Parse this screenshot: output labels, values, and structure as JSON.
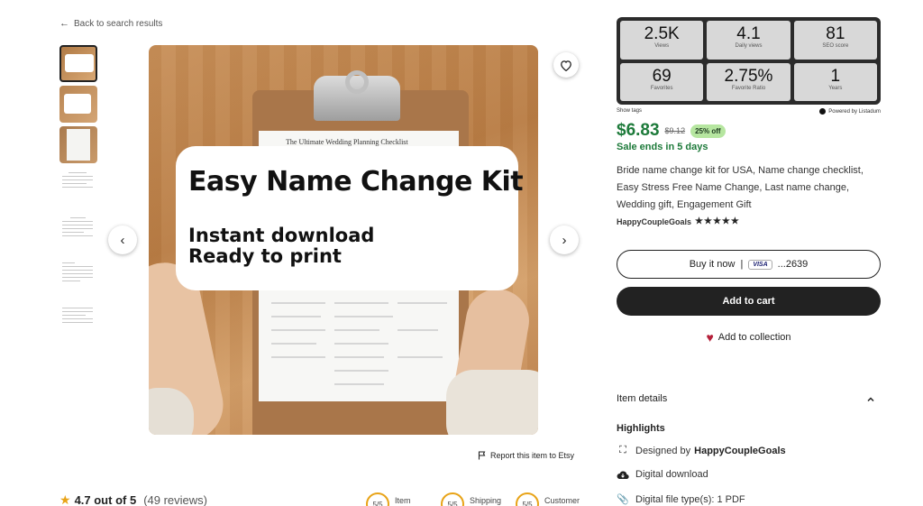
{
  "nav": {
    "back_label": "Back to search results"
  },
  "image": {
    "overlay_title": "Easy Name Change Kit",
    "overlay_line1": "Instant download",
    "overlay_line2": "Ready to print",
    "paper_title": "The Ultimate Wedding Planning Checklist"
  },
  "report_label": "Report this item to Etsy",
  "rating": {
    "score": "4.7 out of 5",
    "reviews": "(49 reviews)"
  },
  "badges": [
    {
      "value": "5/5",
      "label": "Item"
    },
    {
      "value": "5/5",
      "label": "Shipping"
    },
    {
      "value": "5/5",
      "label": "Customer"
    }
  ],
  "stats": [
    {
      "value": "2.5K",
      "label": "Views"
    },
    {
      "value": "4.1",
      "label": "Daily views"
    },
    {
      "value": "81",
      "label": "SEO score"
    },
    {
      "value": "69",
      "label": "Favorites"
    },
    {
      "value": "2.75%",
      "label": "Favorite Ratio"
    },
    {
      "value": "1",
      "label": "Years"
    }
  ],
  "show_tags": "Show tags",
  "powered_by": "Powered by Listadum",
  "price": {
    "current": "$6.83",
    "original": "$9.12",
    "discount": "25% off",
    "sale_ends": "Sale ends in 5 days"
  },
  "listing_title": "Bride name change kit for USA, Name change checklist, Easy Stress Free Name Change, Last name change, Wedding gift, Engagement Gift",
  "shop": {
    "name": "HappyCoupleGoals",
    "stars": "★★★★★"
  },
  "buy_now": {
    "label": "Buy it now",
    "separator": "|",
    "card_brand": "VISA",
    "card_digits": "...2639"
  },
  "add_to_cart": "Add to cart",
  "add_to_collection": "Add to collection",
  "item_details": {
    "label": "Item details"
  },
  "highlights": {
    "title": "Highlights",
    "designed_by_prefix": "Designed by",
    "designed_by_shop": "HappyCoupleGoals",
    "digital_download": "Digital download",
    "file_types": "Digital file type(s): 1 PDF"
  },
  "colors": {
    "price_green": "#1d7a3a",
    "discount_bg": "#b6e6a0",
    "heart_red": "#b5203a",
    "star_gold": "#e8a317"
  }
}
